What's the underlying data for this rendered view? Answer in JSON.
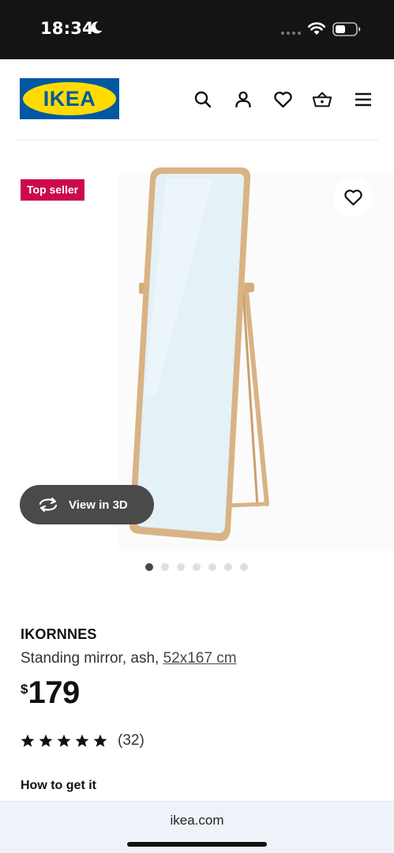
{
  "status_bar": {
    "time": "18:34",
    "icons": [
      "moon-icon",
      "signal-dots-icon",
      "wifi-icon",
      "battery-icon"
    ]
  },
  "header": {
    "logo_text": "IKEA",
    "icons": [
      "search-icon",
      "account-icon",
      "heart-icon",
      "basket-icon",
      "menu-icon"
    ],
    "brand_colors": {
      "blue": "#0058a3",
      "yellow": "#ffdb00"
    }
  },
  "media": {
    "badge": "Top seller",
    "badge_color": "#cc0a4f",
    "view3d_label": "View in 3D",
    "image_count": 7,
    "active_image_index": 0
  },
  "product": {
    "name": "IKORNNES",
    "description": "Standing mirror, ash, ",
    "size_link": "52x167 cm",
    "price_currency": "$",
    "price_amount": "179",
    "rating_stars": 5,
    "rating_count": "(32)",
    "section_heading": "How to get it"
  },
  "browser": {
    "url": "ikea.com"
  }
}
